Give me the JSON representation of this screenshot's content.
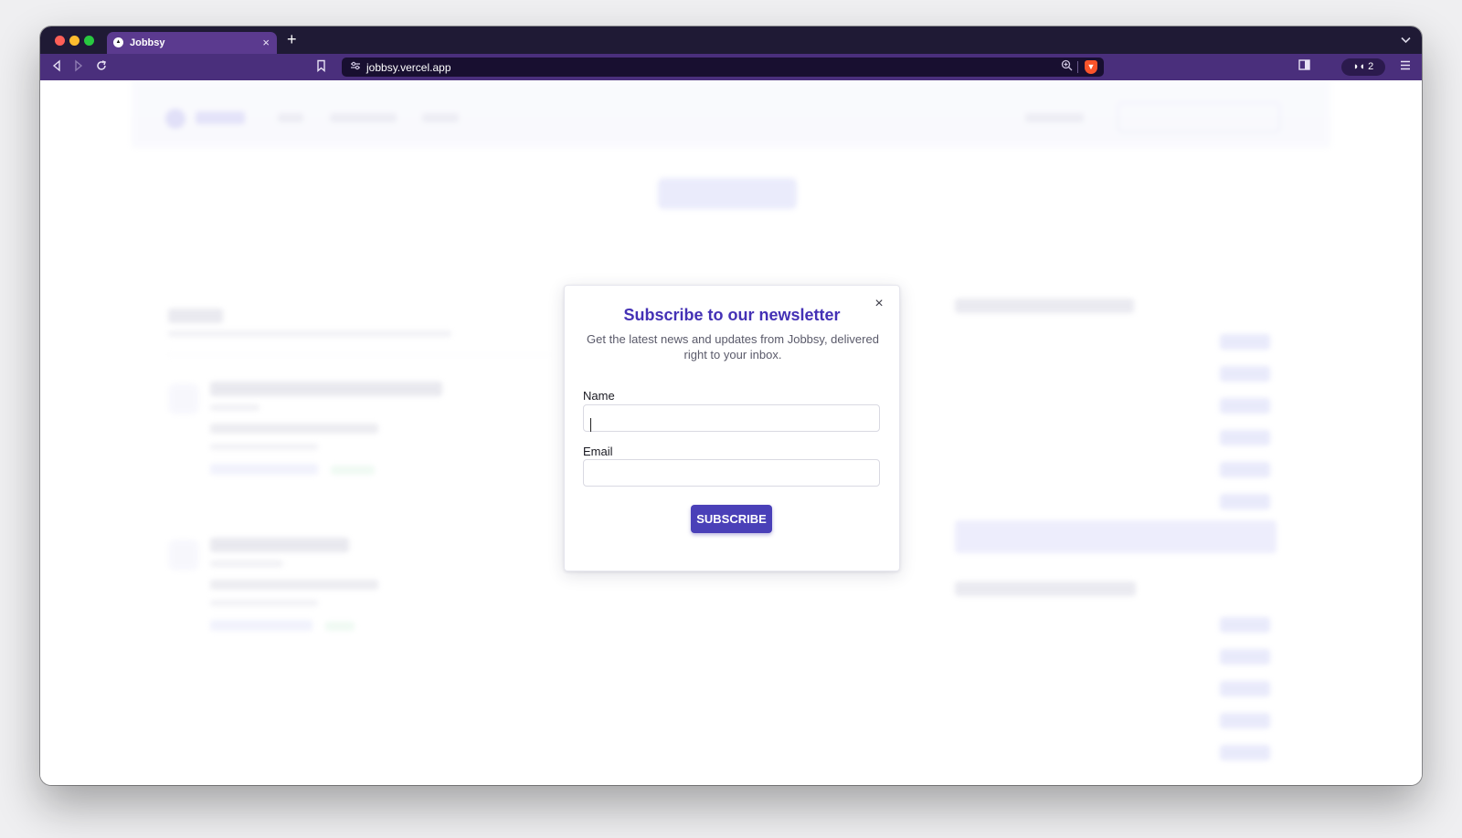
{
  "browser": {
    "tab": {
      "title": "Jobbsy",
      "favicon": "triangle-logo",
      "close": "×"
    },
    "new_tab": "+",
    "tab_list": "⌄",
    "url": "jobbsy.vercel.app",
    "extension_count": "2",
    "nav_icons": [
      "back-icon",
      "forward-icon",
      "reload-icon",
      "bookmark-icon",
      "site-info-icon",
      "zoom-icon",
      "brave-shield-icon",
      "sidebar-icon",
      "menu-icon"
    ]
  },
  "modal": {
    "title": "Subscribe to our newsletter",
    "description": "Get the latest news and updates from Jobbsy, delivered right to your inbox.",
    "name_label": "Name",
    "name_value": "",
    "email_label": "Email",
    "email_value": "",
    "submit_label": "SUBSCRIBE",
    "close_glyph": "×"
  },
  "colors": {
    "accent": "#4431b5",
    "button": "#4a40b8",
    "tab_bar": "#1f1a35",
    "toolbar": "#4a2f7c"
  }
}
